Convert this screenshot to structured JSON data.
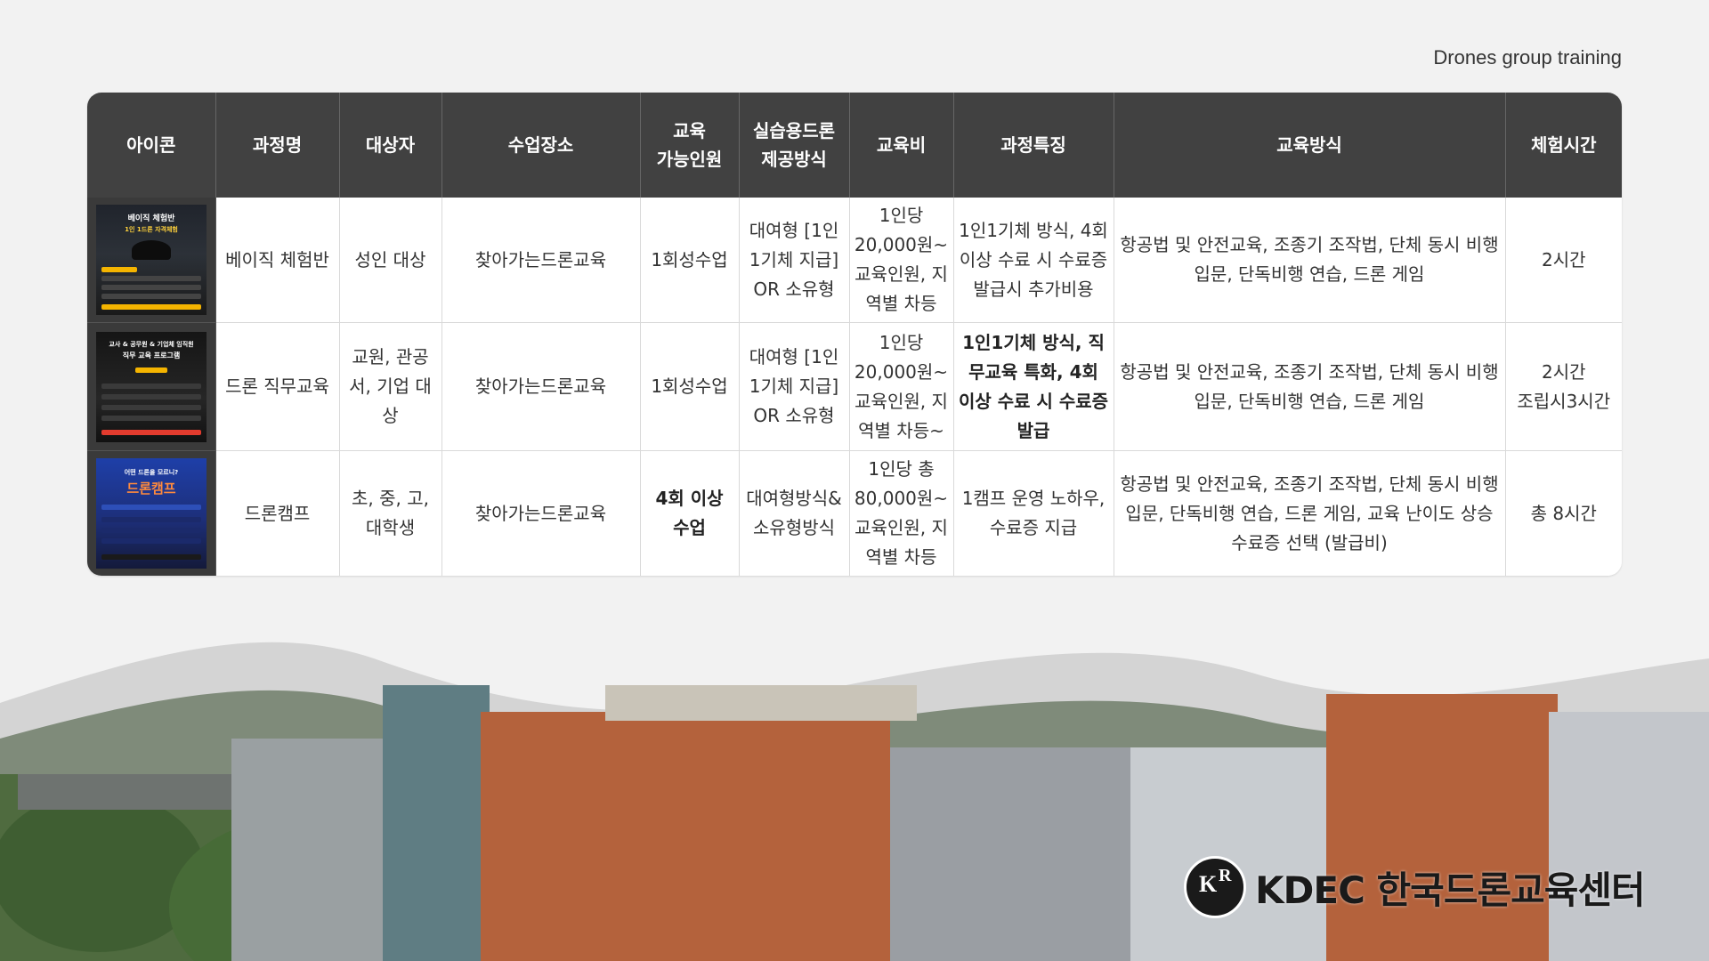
{
  "caption": "Drones group training",
  "headers": [
    "아이콘",
    "과정명",
    "대상자",
    "수업장소",
    "교육\n가능인원",
    "실습용드론\n제공방식",
    "교육비",
    "과정특징",
    "교육방식",
    "체험시간"
  ],
  "rows": [
    {
      "poster": {
        "title": "베이직 체험반",
        "subtitle": "1인 1드론 자격체험"
      },
      "course": "베이직 체험반",
      "target": "성인 대상",
      "place": "찾아가는드론교육",
      "capacity": "1회성수업",
      "drone": "대여형 [1인1기체 지급] OR 소유형",
      "fee": "1인당 20,000원~ 교육인원, 지역별 차등",
      "feature": "1인1기체 방식, 4회 이상 수료 시 수료증 발급시 추가비용",
      "method": "항공법 및 안전교육, 조종기 조작법, 단체 동시 비행 입문, 단독비행 연습, 드론 게임",
      "time": "2시간"
    },
    {
      "poster": {
        "title": "교사 & 공무원 & 기업체 임직원",
        "subtitle": "직무 교육 프로그램"
      },
      "course": "드론 직무교육",
      "target": "교원, 관공서, 기업 대상",
      "place": "찾아가는드론교육",
      "capacity": "1회성수업",
      "drone": "대여형 [1인1기체 지급] OR 소유형",
      "fee": "1인당 20,000원~ 교육인원, 지역별 차등~",
      "feature": "1인1기체 방식, 직무교육 특화, 4회 이상 수료 시 수료증 발급",
      "method": "항공법 및 안전교육, 조종기 조작법, 단체 동시 비행 입문, 단독비행 연습, 드론 게임",
      "time": "2시간\n조립시3시간"
    },
    {
      "poster": {
        "title": "어떤 드론을 모르니?",
        "subtitle": "드론캠프"
      },
      "course": "드론캠프",
      "target": "초, 중, 고, 대학생",
      "place": "찾아가는드론교육",
      "capacity": "4회 이상 수업",
      "drone": "대여형방식& 소유형방식",
      "fee": "1인당 총 80,000원~ 교육인원, 지역별 차등",
      "feature": "1캠프 운영 노하우, 수료증 지급",
      "method": "항공법 및 안전교육, 조종기 조작법, 단체 동시 비행 입문, 단독비행 연습, 드론 게임, 교육 난이도 상승 수료증 선택 (발급비)",
      "time": "총 8시간"
    }
  ],
  "brand": {
    "logo_text": "KR",
    "name": "KDEC 한국드론교육센터"
  },
  "colors": {
    "header_bg": "#414141",
    "page_bg": "#f2f2f2",
    "wave": "#d4d4d4",
    "building_orange": "#b4623c"
  }
}
